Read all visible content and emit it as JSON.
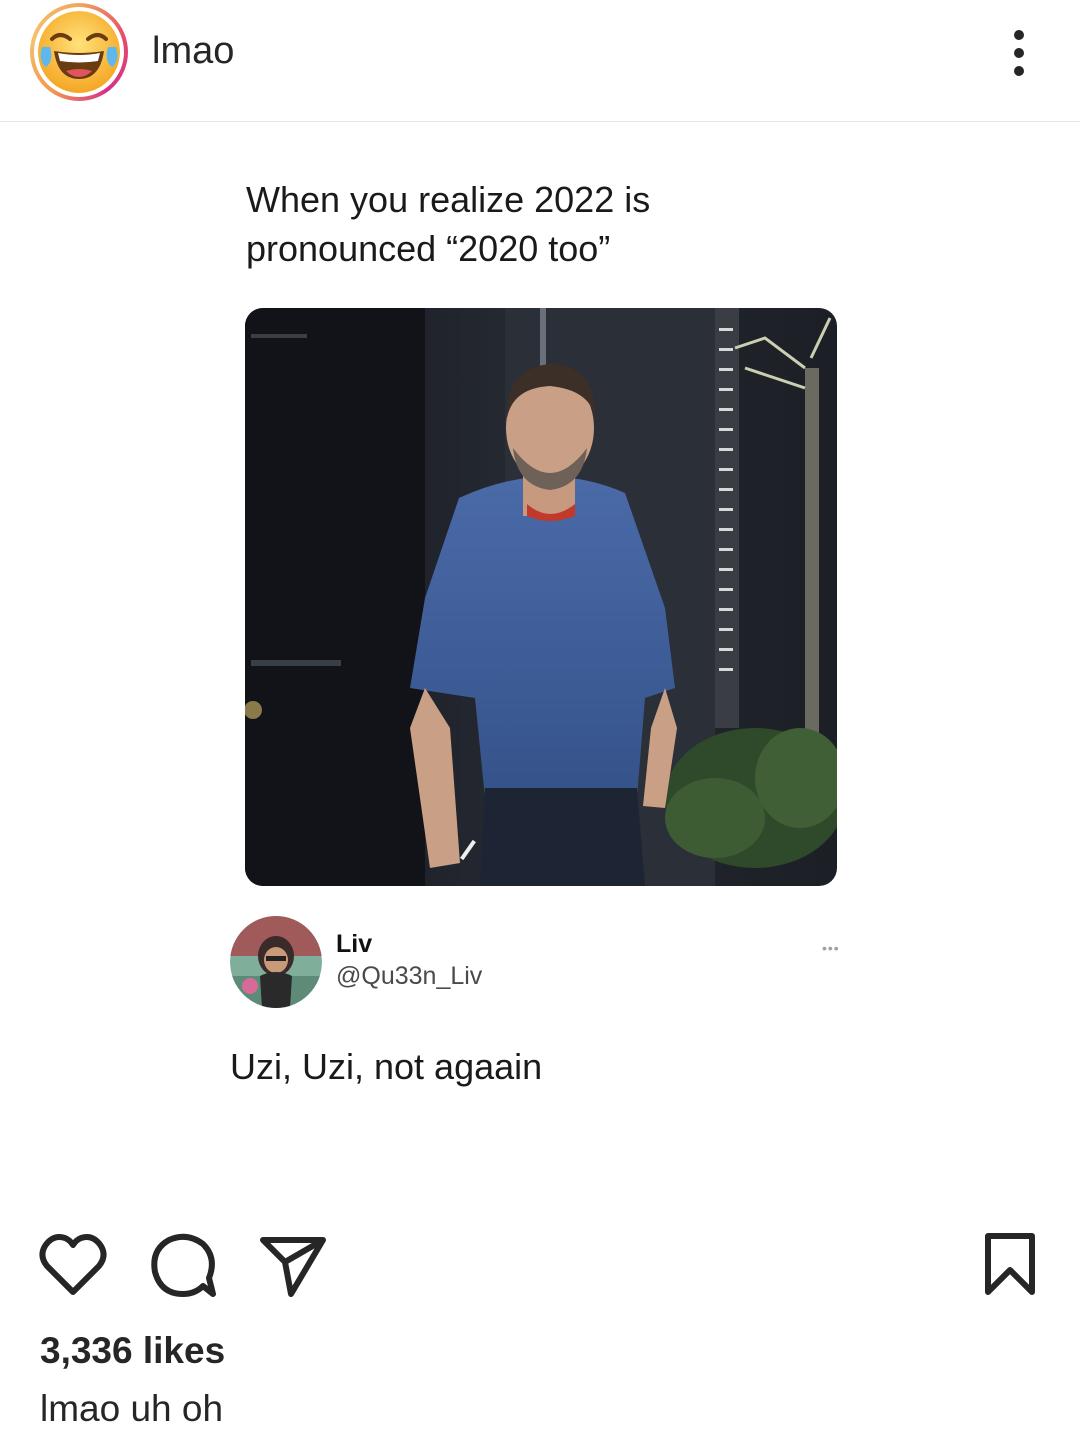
{
  "header": {
    "account_name": "lmao",
    "avatar_icon": "laughing-emoji-icon",
    "more_icon": "more-vertical-icon"
  },
  "post": {
    "tweet_text_line1": "When you realize 2022 is",
    "tweet_text_line2": "pronounced “2020 too”",
    "reply": {
      "name": "Liv",
      "handle": "@Qu33n_Liv",
      "more": "•••",
      "text": "Uzi, Uzi, not agaain"
    }
  },
  "actions": {
    "like_icon": "heart-icon",
    "comment_icon": "comment-icon",
    "share_icon": "send-icon",
    "save_icon": "bookmark-icon"
  },
  "likes": "3,336 likes",
  "caption": {
    "username": "lmao",
    "text": " uh oh"
  }
}
